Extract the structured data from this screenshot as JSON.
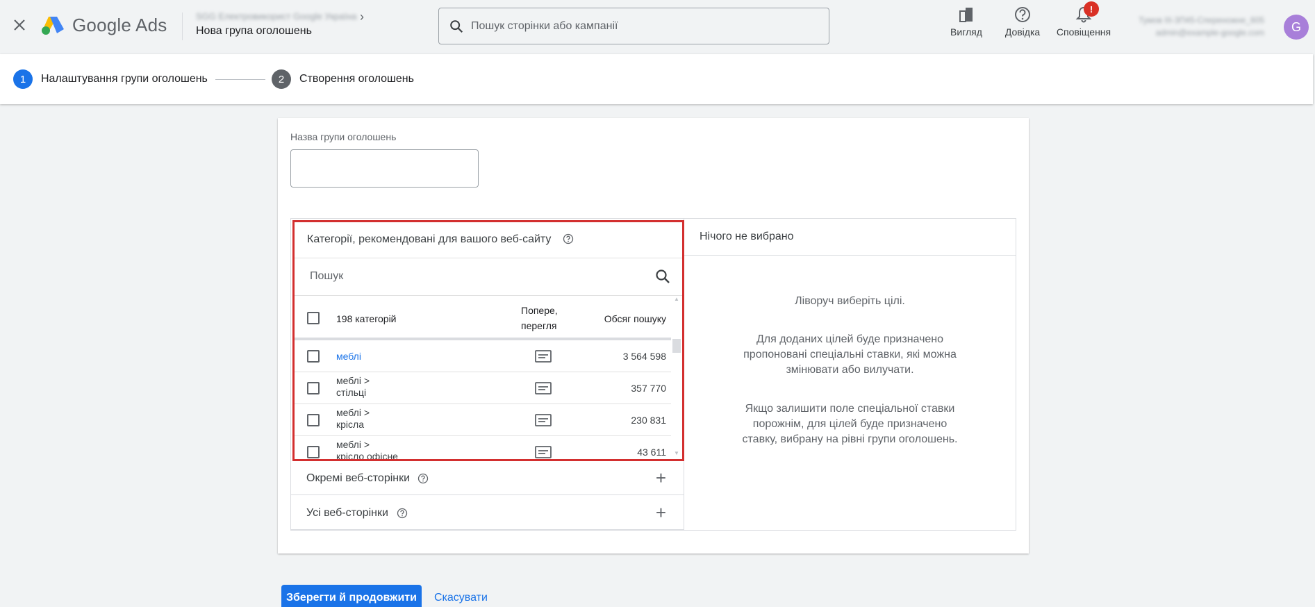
{
  "header": {
    "product_name": "Google Ads",
    "account_name": "SGG Електровикорист Google Україна",
    "page_title": "Нова група оголошень",
    "search_placeholder": "Пошук сторінки або кампанії",
    "view_label": "Вигляд",
    "help_label": "Довідка",
    "notifications_label": "Сповіщення",
    "notifications_badge": "!",
    "account_phone": "Тумов ІІІ-ЗП45-Спереножне_605",
    "account_email": "admin@example-google.com",
    "avatar_letter": "G"
  },
  "stepper": {
    "steps": [
      {
        "num": "1",
        "label": "Налаштування групи оголошень",
        "active": true
      },
      {
        "num": "2",
        "label": "Створення оголошень",
        "active": false
      }
    ],
    "active_color": "#1a73e8",
    "inactive_color": "#5f6368"
  },
  "form": {
    "ad_group_name_label": "Назва групи оголошень",
    "ad_group_name_value": ""
  },
  "categories": {
    "title": "Категорії, рекомендовані для вашого веб-сайту",
    "search_placeholder": "Пошук",
    "count_label": "198 категорій",
    "col_views": "Попере, перегля",
    "col_volume": "Обсяг пошуку",
    "rows": [
      {
        "path": "меблі",
        "sub": "",
        "volume": "3 564 598",
        "link": true
      },
      {
        "path": "меблі >",
        "sub": "стільці",
        "volume": "357 770",
        "link": false
      },
      {
        "path": "меблі >",
        "sub": "крісла",
        "volume": "230 831",
        "link": false
      },
      {
        "path": "меблі >",
        "sub": "крісло офісне",
        "volume": "43 611",
        "link": false
      }
    ]
  },
  "accordions": {
    "web_pages": "Окремі веб-сторінки",
    "all_web_pages": "Усі веб-сторінки"
  },
  "selected": {
    "title": "Нічого не вибрано",
    "msg1": "Ліворуч виберіть цілі.",
    "msg2": "Для доданих цілей буде призначено пропоновані спеціальні ставки, які можна змінювати або вилучати.",
    "msg3": "Якщо залишити поле спеціальної ставки порожнім, для цілей буде призначено ставку, вибрану на рівні групи оголошень."
  },
  "actions": {
    "save_label": "Зберегти й продовжити",
    "cancel_label": "Скасувати"
  },
  "colors": {
    "primary": "#1a73e8",
    "highlight_border": "#d32f2f",
    "badge": "#d93025"
  }
}
